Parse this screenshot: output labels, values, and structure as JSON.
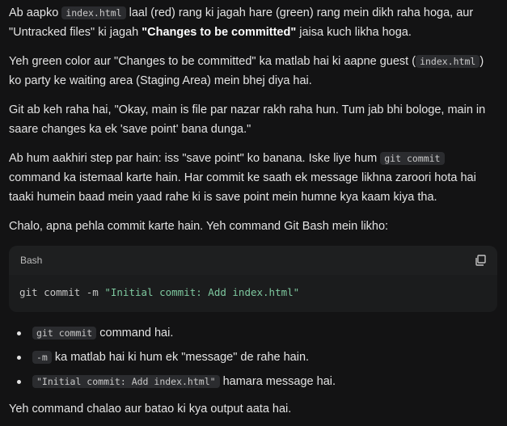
{
  "p1": {
    "a": "Ab aapko ",
    "code": "index.html",
    "b": " laal (red) rang ki jagah hare (green) rang mein dikh raha hoga, aur \"Untracked files\" ki jagah ",
    "bold": "\"Changes to be committed\"",
    "c": " jaisa kuch likha hoga."
  },
  "p2": {
    "a": "Yeh green color aur \"Changes to be committed\" ka matlab hai ki aapne guest (",
    "code": "index.html",
    "b": ") ko party ke waiting area (Staging Area) mein bhej diya hai."
  },
  "p3": "Git ab keh raha hai, \"Okay, main is file par nazar rakh raha hun. Tum jab bhi bologe, main in saare changes ka ek 'save point' bana dunga.\"",
  "p4": {
    "a": "Ab hum aakhiri step par hain: iss \"save point\" ko banana. Iske liye hum ",
    "code": "git commit",
    "b": " command ka istemaal karte hain. Har commit ke saath ek message likhna zaroori hota hai taaki humein baad mein yaad rahe ki is save point mein humne kya kaam kiya tha."
  },
  "p5": "Chalo, apna pehla commit karte hain. Yeh command Git Bash mein likho:",
  "codeblock": {
    "language": "Bash",
    "command": "git commit -m ",
    "string": "\"Initial commit: Add index.html\"",
    "copy_icon": "copy-icon"
  },
  "bullets": [
    {
      "code": "git commit",
      "text": " command hai."
    },
    {
      "code": "-m",
      "text": " ka matlab hai ki hum ek \"message\" de rahe hain."
    },
    {
      "code": "\"Initial commit: Add index.html\"",
      "text": " hamara message hai."
    }
  ],
  "p6": "Yeh command chalao aur batao ki kya output aata hai.",
  "colors": {
    "background": "#131314",
    "code_bg": "#2b2c2f",
    "string_green": "#7ec89f"
  }
}
